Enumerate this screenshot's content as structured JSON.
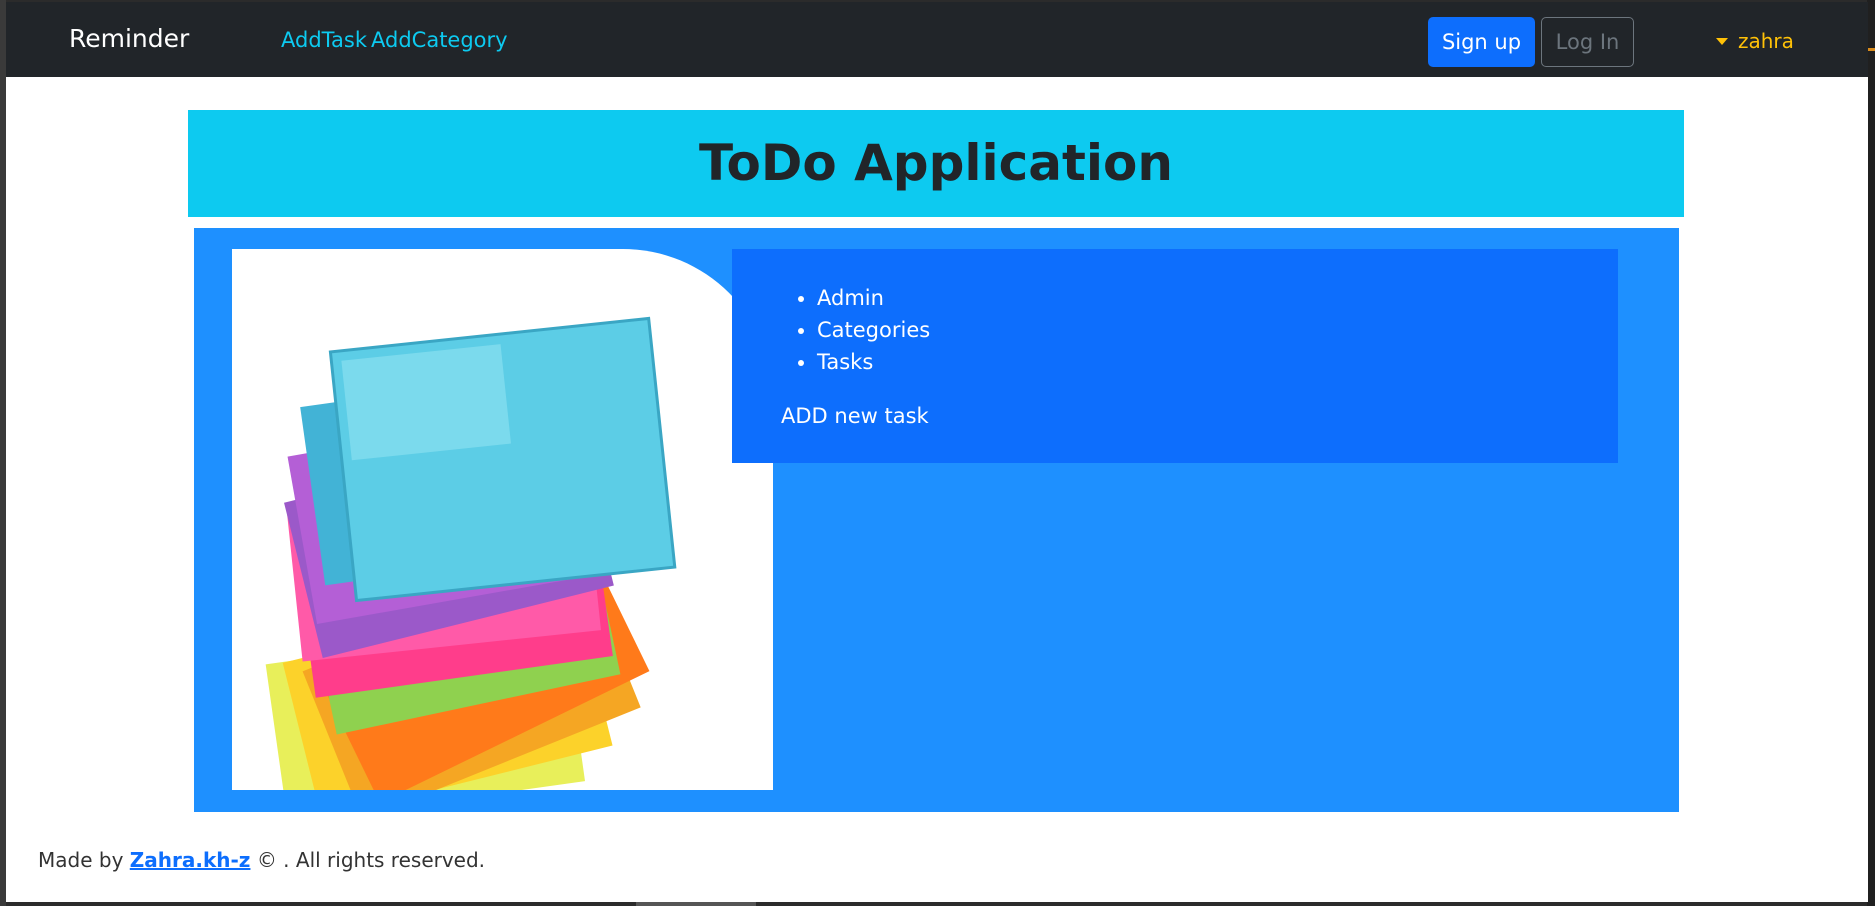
{
  "navbar": {
    "brand": "Reminder",
    "links": [
      "AddTask",
      "AddCategory"
    ],
    "signup_label": "Sign up",
    "login_label": "Log In",
    "user_name": "zahra"
  },
  "hero": {
    "title": "ToDo Application"
  },
  "menu": {
    "items": [
      "Admin",
      "Categories",
      "Tasks"
    ],
    "add_task_label": "ADD new task"
  },
  "footer": {
    "prefix": "Made by",
    "author_link": "Zahra.kh-z",
    "suffix": "© . All rights reserved."
  },
  "colors": {
    "navbar_bg": "#212529",
    "link": "#0dcaf0",
    "primary": "#0d6efd",
    "hero_bg": "#0dcaf0",
    "main_bg": "#1e90ff",
    "user": "#ffc107"
  },
  "images": {
    "sticky_notes": "stack-of-colorful-sticky-notes-image"
  }
}
